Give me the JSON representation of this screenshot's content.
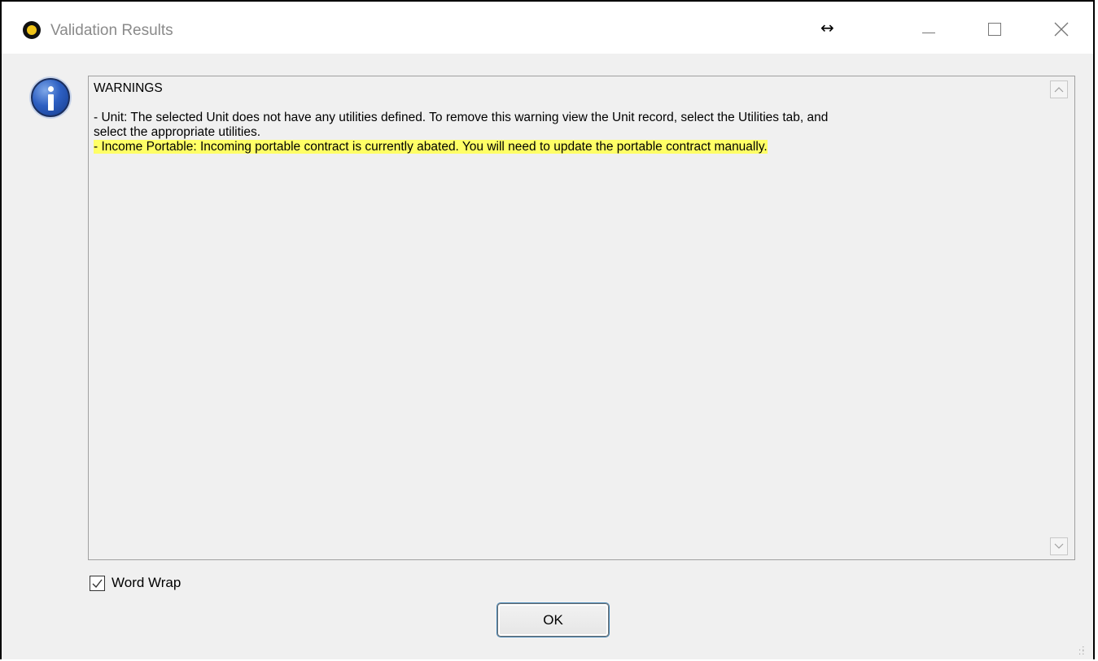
{
  "window": {
    "title": "Validation Results",
    "icon": "app-logo-icon",
    "controls": {
      "minimize": "minimize-icon",
      "maximize": "maximize-icon",
      "close": "close-icon"
    }
  },
  "dialog": {
    "icon": "info-icon",
    "text_lines": [
      "WARNINGS",
      "",
      "- Unit: The selected Unit does not have any utilities defined. To remove this warning view the Unit record, select the Utilities tab, and",
      "select the appropriate utilities.",
      "- Income Portable: Incoming portable contract is currently abated. You will need to update the portable contract manually."
    ],
    "highlight_color": "#ffff66",
    "word_wrap": {
      "label": "Word Wrap",
      "checked": true
    },
    "ok_label": "OK"
  }
}
